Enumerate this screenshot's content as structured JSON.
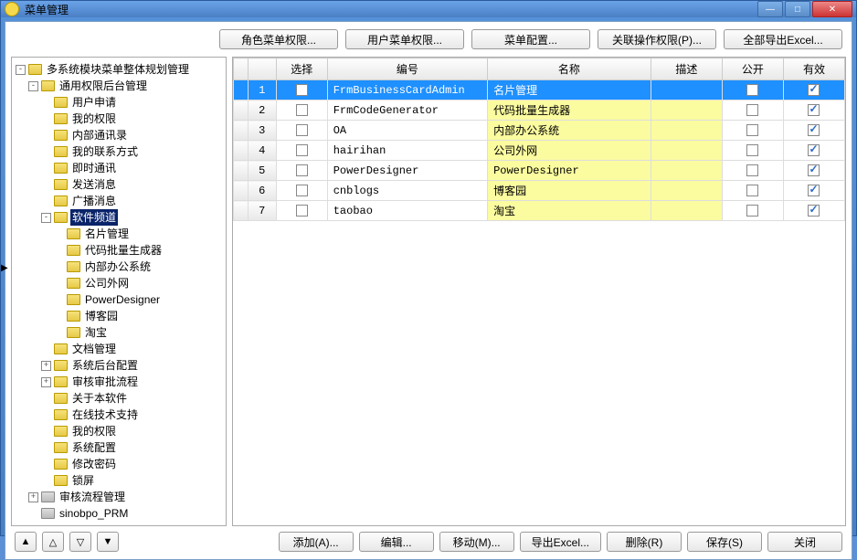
{
  "window": {
    "title": "菜单管理"
  },
  "toolbar_top": {
    "role_perm": "角色菜单权限...",
    "user_perm": "用户菜单权限...",
    "menu_config": "菜单配置...",
    "relate_op": "关联操作权限(P)...",
    "export_all": "全部导出Excel..."
  },
  "tree": {
    "root": {
      "label": "多系统模块菜单整体规划管理",
      "expanded": true
    },
    "children": [
      {
        "label": "通用权限后台管理",
        "expanded": true,
        "children": [
          {
            "label": "用户申请"
          },
          {
            "label": "我的权限"
          },
          {
            "label": "内部通讯录"
          },
          {
            "label": "我的联系方式"
          },
          {
            "label": "即时通讯"
          },
          {
            "label": "发送消息"
          },
          {
            "label": "广播消息"
          },
          {
            "label": "软件频道",
            "expanded": true,
            "selected": true,
            "children": [
              {
                "label": "名片管理"
              },
              {
                "label": "代码批量生成器"
              },
              {
                "label": "内部办公系统"
              },
              {
                "label": "公司外网"
              },
              {
                "label": "PowerDesigner"
              },
              {
                "label": "博客园"
              },
              {
                "label": "淘宝"
              }
            ]
          },
          {
            "label": "文档管理"
          },
          {
            "label": "系统后台配置",
            "expandable": true
          },
          {
            "label": "审核审批流程",
            "expandable": true
          },
          {
            "label": "关于本软件"
          },
          {
            "label": "在线技术支持"
          },
          {
            "label": "我的权限"
          },
          {
            "label": "系统配置"
          },
          {
            "label": "修改密码"
          },
          {
            "label": "锁屏"
          }
        ]
      },
      {
        "label": "审核流程管理",
        "expandable": true,
        "grey": true
      },
      {
        "label": "sinobpo_PRM",
        "grey": true
      }
    ]
  },
  "grid": {
    "columns": {
      "select": "选择",
      "code": "编号",
      "name": "名称",
      "desc": "描述",
      "public": "公开",
      "valid": "有效"
    },
    "rows": [
      {
        "num": "1",
        "selected": true,
        "sel": false,
        "code": "FrmBusinessCardAdmin",
        "name": "名片管理",
        "public": false,
        "valid": true
      },
      {
        "num": "2",
        "sel": false,
        "code": "FrmCodeGenerator",
        "name": "代码批量生成器",
        "public": false,
        "valid": true
      },
      {
        "num": "3",
        "sel": false,
        "code": "OA",
        "name": "内部办公系统",
        "public": false,
        "valid": true
      },
      {
        "num": "4",
        "sel": false,
        "code": "hairihan",
        "name": "公司外网",
        "public": false,
        "valid": true
      },
      {
        "num": "5",
        "sel": false,
        "code": "PowerDesigner",
        "name": "PowerDesigner",
        "public": false,
        "valid": true
      },
      {
        "num": "6",
        "sel": false,
        "code": "cnblogs",
        "name": "博客园",
        "public": false,
        "valid": true
      },
      {
        "num": "7",
        "sel": false,
        "code": "taobao",
        "name": "淘宝",
        "public": false,
        "valid": true
      }
    ]
  },
  "footer": {
    "add": "添加(A)...",
    "edit": "编辑...",
    "move": "移动(M)...",
    "export": "导出Excel...",
    "delete": "删除(R)",
    "save": "保存(S)",
    "close": "关闭"
  }
}
